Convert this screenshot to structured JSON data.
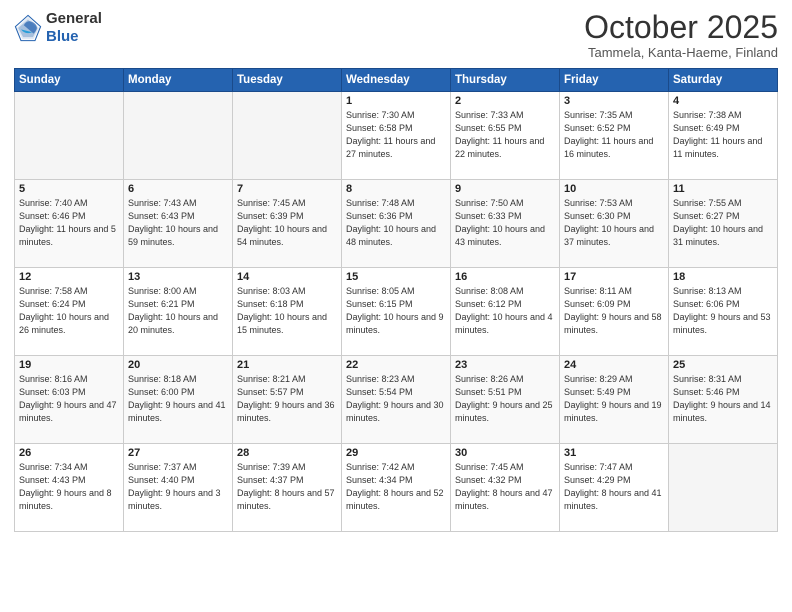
{
  "header": {
    "logo_general": "General",
    "logo_blue": "Blue",
    "month": "October 2025",
    "location": "Tammela, Kanta-Haeme, Finland"
  },
  "weekdays": [
    "Sunday",
    "Monday",
    "Tuesday",
    "Wednesday",
    "Thursday",
    "Friday",
    "Saturday"
  ],
  "weeks": [
    [
      {
        "day": "",
        "sunrise": "",
        "sunset": "",
        "daylight": ""
      },
      {
        "day": "",
        "sunrise": "",
        "sunset": "",
        "daylight": ""
      },
      {
        "day": "",
        "sunrise": "",
        "sunset": "",
        "daylight": ""
      },
      {
        "day": "1",
        "sunrise": "Sunrise: 7:30 AM",
        "sunset": "Sunset: 6:58 PM",
        "daylight": "Daylight: 11 hours and 27 minutes."
      },
      {
        "day": "2",
        "sunrise": "Sunrise: 7:33 AM",
        "sunset": "Sunset: 6:55 PM",
        "daylight": "Daylight: 11 hours and 22 minutes."
      },
      {
        "day": "3",
        "sunrise": "Sunrise: 7:35 AM",
        "sunset": "Sunset: 6:52 PM",
        "daylight": "Daylight: 11 hours and 16 minutes."
      },
      {
        "day": "4",
        "sunrise": "Sunrise: 7:38 AM",
        "sunset": "Sunset: 6:49 PM",
        "daylight": "Daylight: 11 hours and 11 minutes."
      }
    ],
    [
      {
        "day": "5",
        "sunrise": "Sunrise: 7:40 AM",
        "sunset": "Sunset: 6:46 PM",
        "daylight": "Daylight: 11 hours and 5 minutes."
      },
      {
        "day": "6",
        "sunrise": "Sunrise: 7:43 AM",
        "sunset": "Sunset: 6:43 PM",
        "daylight": "Daylight: 10 hours and 59 minutes."
      },
      {
        "day": "7",
        "sunrise": "Sunrise: 7:45 AM",
        "sunset": "Sunset: 6:39 PM",
        "daylight": "Daylight: 10 hours and 54 minutes."
      },
      {
        "day": "8",
        "sunrise": "Sunrise: 7:48 AM",
        "sunset": "Sunset: 6:36 PM",
        "daylight": "Daylight: 10 hours and 48 minutes."
      },
      {
        "day": "9",
        "sunrise": "Sunrise: 7:50 AM",
        "sunset": "Sunset: 6:33 PM",
        "daylight": "Daylight: 10 hours and 43 minutes."
      },
      {
        "day": "10",
        "sunrise": "Sunrise: 7:53 AM",
        "sunset": "Sunset: 6:30 PM",
        "daylight": "Daylight: 10 hours and 37 minutes."
      },
      {
        "day": "11",
        "sunrise": "Sunrise: 7:55 AM",
        "sunset": "Sunset: 6:27 PM",
        "daylight": "Daylight: 10 hours and 31 minutes."
      }
    ],
    [
      {
        "day": "12",
        "sunrise": "Sunrise: 7:58 AM",
        "sunset": "Sunset: 6:24 PM",
        "daylight": "Daylight: 10 hours and 26 minutes."
      },
      {
        "day": "13",
        "sunrise": "Sunrise: 8:00 AM",
        "sunset": "Sunset: 6:21 PM",
        "daylight": "Daylight: 10 hours and 20 minutes."
      },
      {
        "day": "14",
        "sunrise": "Sunrise: 8:03 AM",
        "sunset": "Sunset: 6:18 PM",
        "daylight": "Daylight: 10 hours and 15 minutes."
      },
      {
        "day": "15",
        "sunrise": "Sunrise: 8:05 AM",
        "sunset": "Sunset: 6:15 PM",
        "daylight": "Daylight: 10 hours and 9 minutes."
      },
      {
        "day": "16",
        "sunrise": "Sunrise: 8:08 AM",
        "sunset": "Sunset: 6:12 PM",
        "daylight": "Daylight: 10 hours and 4 minutes."
      },
      {
        "day": "17",
        "sunrise": "Sunrise: 8:11 AM",
        "sunset": "Sunset: 6:09 PM",
        "daylight": "Daylight: 9 hours and 58 minutes."
      },
      {
        "day": "18",
        "sunrise": "Sunrise: 8:13 AM",
        "sunset": "Sunset: 6:06 PM",
        "daylight": "Daylight: 9 hours and 53 minutes."
      }
    ],
    [
      {
        "day": "19",
        "sunrise": "Sunrise: 8:16 AM",
        "sunset": "Sunset: 6:03 PM",
        "daylight": "Daylight: 9 hours and 47 minutes."
      },
      {
        "day": "20",
        "sunrise": "Sunrise: 8:18 AM",
        "sunset": "Sunset: 6:00 PM",
        "daylight": "Daylight: 9 hours and 41 minutes."
      },
      {
        "day": "21",
        "sunrise": "Sunrise: 8:21 AM",
        "sunset": "Sunset: 5:57 PM",
        "daylight": "Daylight: 9 hours and 36 minutes."
      },
      {
        "day": "22",
        "sunrise": "Sunrise: 8:23 AM",
        "sunset": "Sunset: 5:54 PM",
        "daylight": "Daylight: 9 hours and 30 minutes."
      },
      {
        "day": "23",
        "sunrise": "Sunrise: 8:26 AM",
        "sunset": "Sunset: 5:51 PM",
        "daylight": "Daylight: 9 hours and 25 minutes."
      },
      {
        "day": "24",
        "sunrise": "Sunrise: 8:29 AM",
        "sunset": "Sunset: 5:49 PM",
        "daylight": "Daylight: 9 hours and 19 minutes."
      },
      {
        "day": "25",
        "sunrise": "Sunrise: 8:31 AM",
        "sunset": "Sunset: 5:46 PM",
        "daylight": "Daylight: 9 hours and 14 minutes."
      }
    ],
    [
      {
        "day": "26",
        "sunrise": "Sunrise: 7:34 AM",
        "sunset": "Sunset: 4:43 PM",
        "daylight": "Daylight: 9 hours and 8 minutes."
      },
      {
        "day": "27",
        "sunrise": "Sunrise: 7:37 AM",
        "sunset": "Sunset: 4:40 PM",
        "daylight": "Daylight: 9 hours and 3 minutes."
      },
      {
        "day": "28",
        "sunrise": "Sunrise: 7:39 AM",
        "sunset": "Sunset: 4:37 PM",
        "daylight": "Daylight: 8 hours and 57 minutes."
      },
      {
        "day": "29",
        "sunrise": "Sunrise: 7:42 AM",
        "sunset": "Sunset: 4:34 PM",
        "daylight": "Daylight: 8 hours and 52 minutes."
      },
      {
        "day": "30",
        "sunrise": "Sunrise: 7:45 AM",
        "sunset": "Sunset: 4:32 PM",
        "daylight": "Daylight: 8 hours and 47 minutes."
      },
      {
        "day": "31",
        "sunrise": "Sunrise: 7:47 AM",
        "sunset": "Sunset: 4:29 PM",
        "daylight": "Daylight: 8 hours and 41 minutes."
      },
      {
        "day": "",
        "sunrise": "",
        "sunset": "",
        "daylight": ""
      }
    ]
  ]
}
